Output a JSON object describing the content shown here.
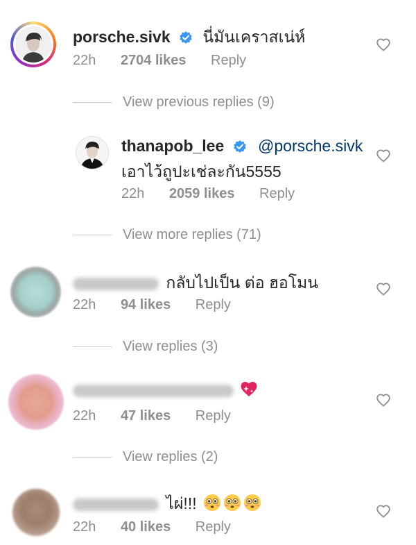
{
  "comments": [
    {
      "username": "porsche.sivk",
      "text": "นี่มันเคราสเน่ห์",
      "time": "22h",
      "likes": "2704 likes",
      "reply": "Reply"
    },
    {
      "username": "thanapob_lee",
      "mention": "@porsche.sivk",
      "text": "เอาไว้ถูปะเช่ละกัน5555",
      "time": "22h",
      "likes": "2059 likes",
      "reply": "Reply"
    },
    {
      "text": "กลับไปเป็น ต่อ ฮอโมน",
      "time": "22h",
      "likes": "94 likes",
      "reply": "Reply"
    },
    {
      "time": "22h",
      "likes": "47 likes",
      "reply": "Reply"
    },
    {
      "text": "ไผ่!!!",
      "time": "22h",
      "likes": "40 likes",
      "reply": "Reply"
    }
  ],
  "view_links": {
    "previous": "View previous replies (9)",
    "more": "View more replies (71)",
    "replies_3": "View replies (3)",
    "replies_2": "View replies (2)"
  },
  "icons": {
    "verified": "verified-badge-icon",
    "heart": "heart-outline-icon",
    "sparkling_heart": "sparkling-heart-emoji",
    "flushed": "flushed-face-emoji"
  },
  "colors": {
    "verified": "#3897f0",
    "mention": "#00376b",
    "meta": "#8e8e8e"
  }
}
